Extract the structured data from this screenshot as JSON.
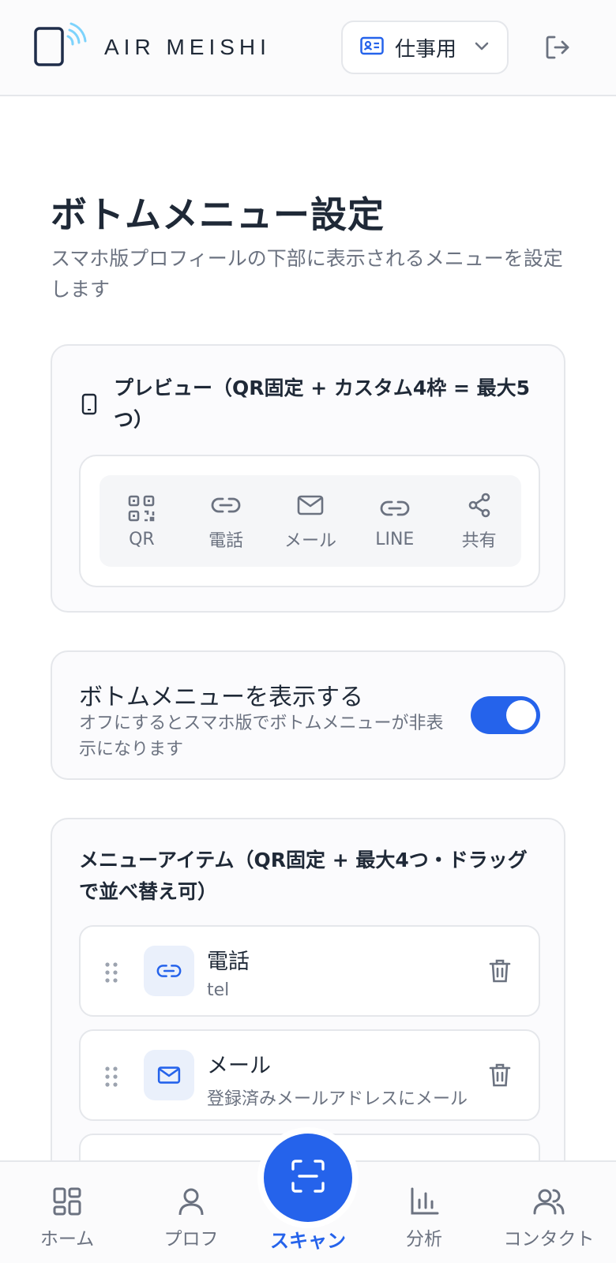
{
  "header": {
    "brand": "AIR MEISHI",
    "profile_select_label": "仕事用",
    "icons": [
      "logo-icon",
      "id-card-icon",
      "chevron-down-icon",
      "logout-icon"
    ]
  },
  "page": {
    "title": "ボトムメニュー設定",
    "subtitle": "スマホ版プロフィールの下部に表示されるメニューを設定します"
  },
  "preview": {
    "title": "プレビュー（QR固定 + カスタム4枠 = 最大5つ）",
    "buttons": [
      {
        "label": "QR",
        "icon": "qr-code-icon"
      },
      {
        "label": "電話",
        "icon": "link-icon"
      },
      {
        "label": "メール",
        "icon": "mail-icon"
      },
      {
        "label": "LINE",
        "icon": "link-icon"
      },
      {
        "label": "共有",
        "icon": "share-icon"
      }
    ]
  },
  "toggle_section": {
    "title": "ボトムメニューを表示する",
    "description": "オフにするとスマホ版でボトムメニューが非表示になります",
    "enabled": true
  },
  "menu_items": {
    "title": "メニューアイテム（QR固定 + 最大4つ・ドラッグで並べ替え可）",
    "items": [
      {
        "name": "電話",
        "description": "tel",
        "icon": "link-icon"
      },
      {
        "name": "メール",
        "description": "登録済みメールアドレスにメール",
        "icon": "mail-icon"
      }
    ]
  },
  "bottom_nav": {
    "items": [
      {
        "label": "ホーム",
        "icon": "grid-icon"
      },
      {
        "label": "プロフ",
        "icon": "user-icon"
      },
      {
        "label": "スキャン",
        "icon": "scan-icon",
        "active": true
      },
      {
        "label": "分析",
        "icon": "bar-chart-icon"
      },
      {
        "label": "コンタクト",
        "icon": "users-icon"
      }
    ]
  },
  "colors": {
    "accent": "#2563eb",
    "text": "#1f2937",
    "muted": "#6b7280",
    "border": "#e5e7eb"
  }
}
